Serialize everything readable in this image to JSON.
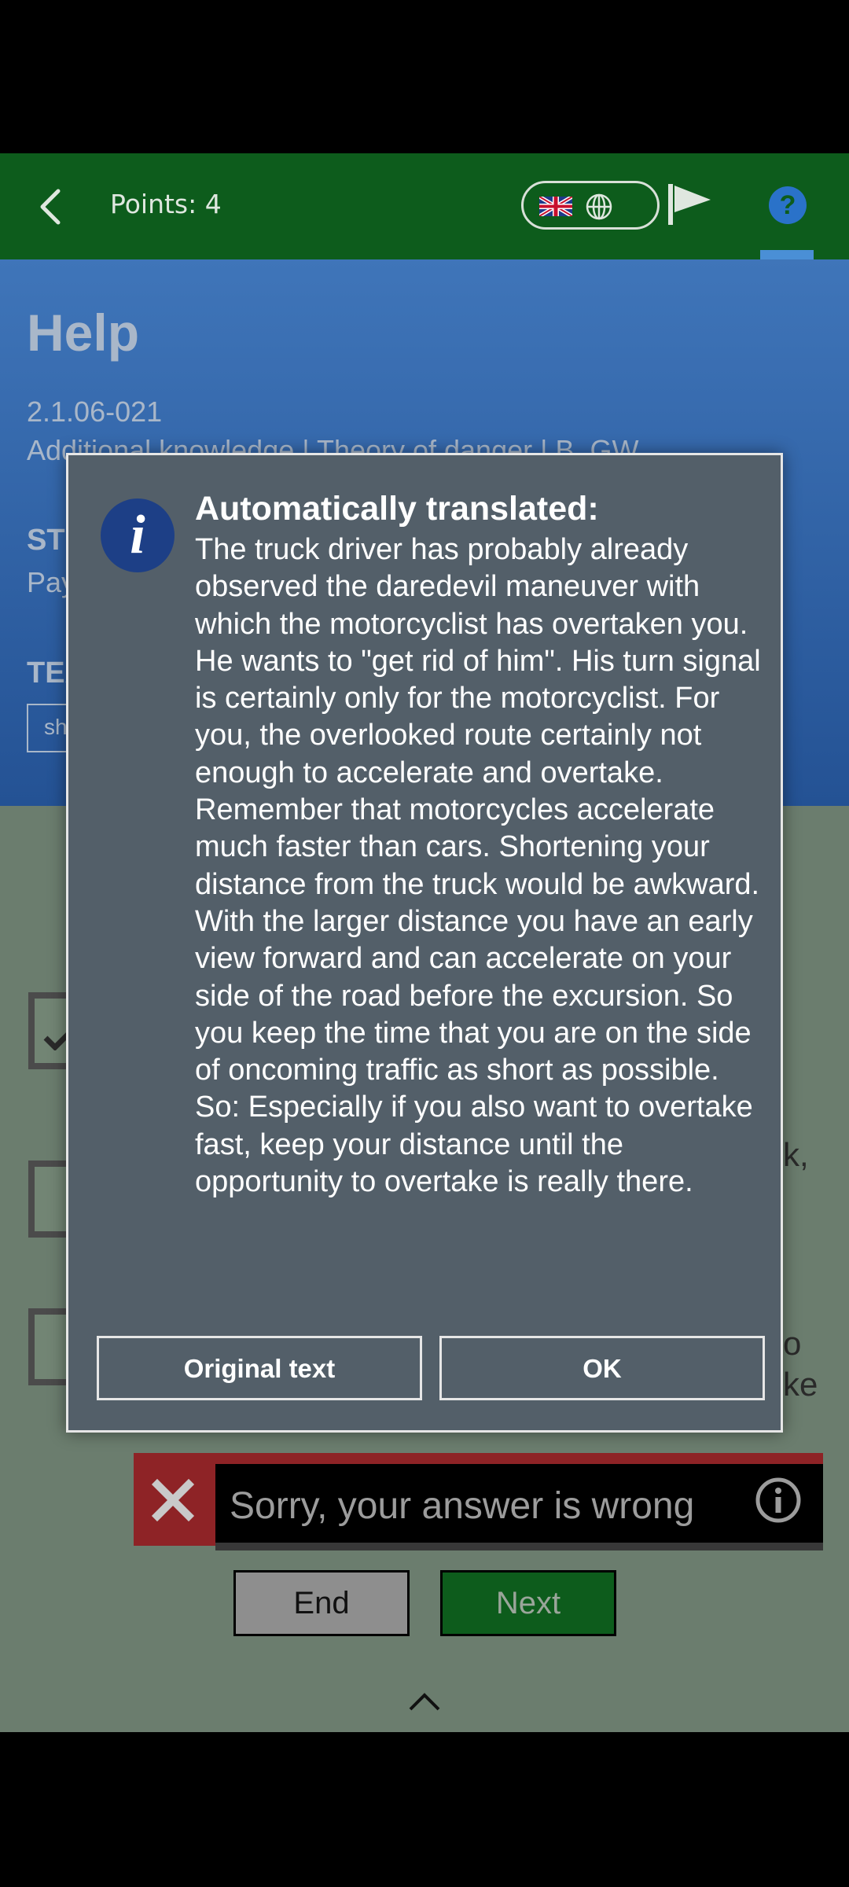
{
  "header": {
    "points_label": "Points: 4"
  },
  "help": {
    "title": "Help",
    "question_code": "2.1.06-021",
    "category_path": "Additional knowledge | Theory of danger | B, GW",
    "statistics_label": "ST",
    "statistics_text": "Pay",
    "teacher_label": "TEA",
    "share_button": "sh"
  },
  "answers": {
    "fragment_1": "k,",
    "fragment_2": "o",
    "fragment_3": "ke"
  },
  "result": {
    "wrong_text": "Sorry, your answer is wrong"
  },
  "nav": {
    "end_label": "End",
    "next_label": "Next"
  },
  "dialog": {
    "heading": "Automatically translated:",
    "body": "The truck driver has probably already observed the daredevil maneuver with which the motorcyclist has overtaken you. He wants to \"get rid of him\". His turn signal is certainly only for the motorcyclist. For you, the overlooked route certainly not enough to accelerate and overtake. Remember that motorcycles accelerate much faster than cars. Shortening your distance from the truck would be awkward. With the larger distance you have an early view forward and can accelerate on your side of the road before the excursion. So you keep the time that you are on the side of oncoming traffic as short as possible. So: Especially if you also want to overtake fast, keep your distance until the opportunity to overtake is really there.",
    "original_text_button": "Original text",
    "ok_button": "OK"
  },
  "icons": {
    "back": "back-arrow-icon",
    "flag": "uk-flag-icon",
    "globe": "globe-icon",
    "report": "report-flag-icon",
    "help": "help-icon",
    "info": "info-icon",
    "wrong": "close-x-icon",
    "wrong_info": "info-outline-icon",
    "collapse": "chevron-up-icon"
  },
  "colors": {
    "header_green": "#0d5c1c",
    "help_blue": "#2f64a8",
    "dialog_bg": "#535f69",
    "wrong_red": "#8e2326",
    "info_blue": "#1d3f86"
  }
}
